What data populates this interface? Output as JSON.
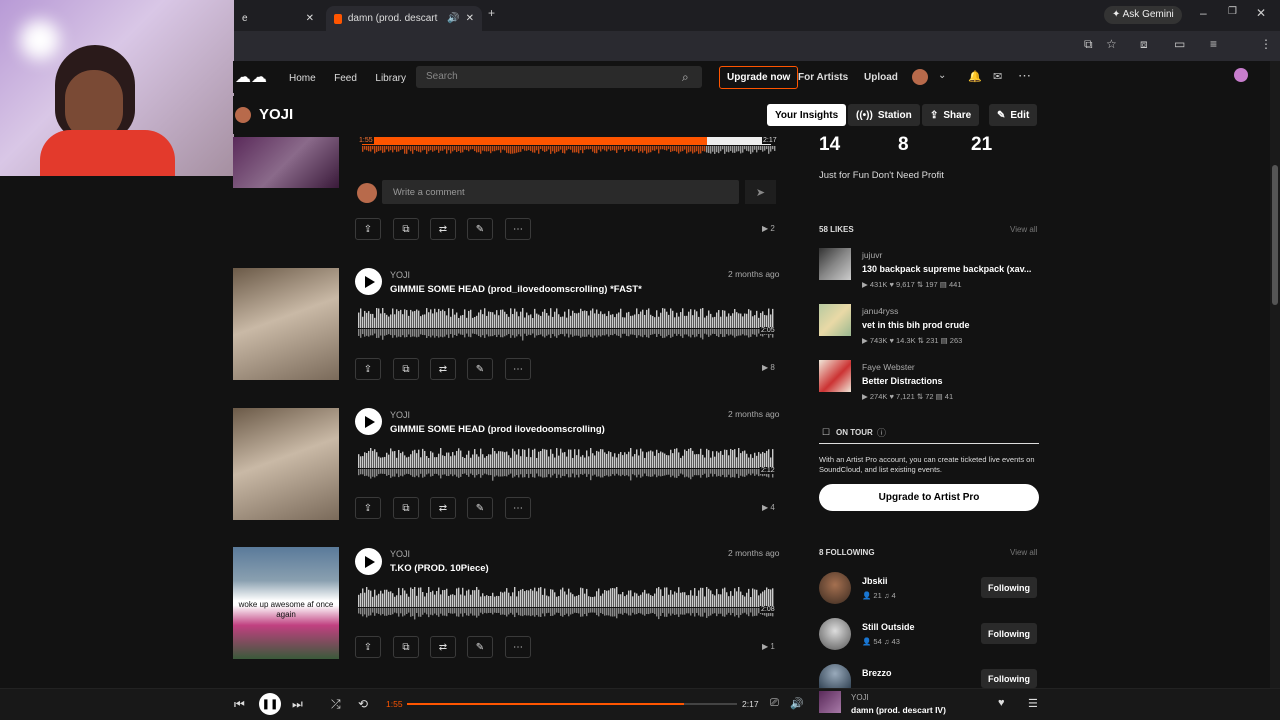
{
  "browser": {
    "tab1_label": "e",
    "tab2_label": "damn (prod. descart IV) by",
    "ask_gemini": "Ask Gemini"
  },
  "header": {
    "nav": [
      "Home",
      "Feed",
      "Library"
    ],
    "search_placeholder": "Search",
    "upgrade": "Upgrade now",
    "for_artists": "For Artists",
    "upload": "Upload"
  },
  "profile": {
    "name": "YOJI",
    "buttons": {
      "insights": "Your Insights",
      "station": "Station",
      "share": "Share",
      "edit": "Edit"
    }
  },
  "first_track": {
    "comment_placeholder": "Write a comment",
    "time_left": "1:55",
    "time_right": "2:17",
    "plays": "2"
  },
  "tracks": [
    {
      "artist": "YOJI",
      "title": "GIMMIE SOME HEAD (prod_ilovedoomscrolling) *FAST*",
      "ago": "2 months ago",
      "duration": "2:05",
      "plays": "8"
    },
    {
      "artist": "YOJI",
      "title": "GIMMIE SOME HEAD (prod ilovedoomscrolling)",
      "ago": "2 months ago",
      "duration": "2:12",
      "plays": "4"
    },
    {
      "artist": "YOJI",
      "title": "T.KO (PROD. 10Piece)",
      "ago": "2 months ago",
      "duration": "2:08",
      "plays": "1",
      "thumb_caption": "woke up awesome af once again"
    }
  ],
  "stats": {
    "a": "14",
    "b": "8",
    "c": "21"
  },
  "bio": "Just for Fun Don't Need Profit",
  "likes": {
    "header": "58 LIKES",
    "view_all": "View all",
    "items": [
      {
        "artist": "jujuvr",
        "title": "130 backpack supreme backpack (xav...",
        "stats": "▶ 431K  ♥ 9,617  ⇅ 197  ▤ 441"
      },
      {
        "artist": "janu4ryss",
        "title": "vet in this bih prod crude",
        "stats": "▶ 743K  ♥ 14.3K  ⇅ 231  ▤ 263"
      },
      {
        "artist": "Faye Webster",
        "title": "Better Distractions",
        "stats": "▶ 274K  ♥ 7,121  ⇅ 72  ▤ 41"
      }
    ]
  },
  "tour": {
    "header": "ON TOUR",
    "text": "With an Artist Pro account, you can create ticketed live events on SoundCloud, and list existing events.",
    "button": "Upgrade to Artist Pro"
  },
  "following": {
    "header": "8 FOLLOWING",
    "view_all": "View all",
    "items": [
      {
        "name": "Jbskii",
        "stats": "👤 21  ♫ 4",
        "button": "Following"
      },
      {
        "name": "Still Outside",
        "stats": "👤 54  ♫ 43",
        "button": "Following"
      },
      {
        "name": "Brezzo",
        "stats": "",
        "button": "Following"
      }
    ]
  },
  "player": {
    "elapsed": "1:55",
    "total": "2:17",
    "progress": 0.84,
    "artist": "YOJI",
    "title": "damn (prod. descart IV)"
  },
  "colors": {
    "accent": "#ff5500",
    "bg": "#121212"
  }
}
